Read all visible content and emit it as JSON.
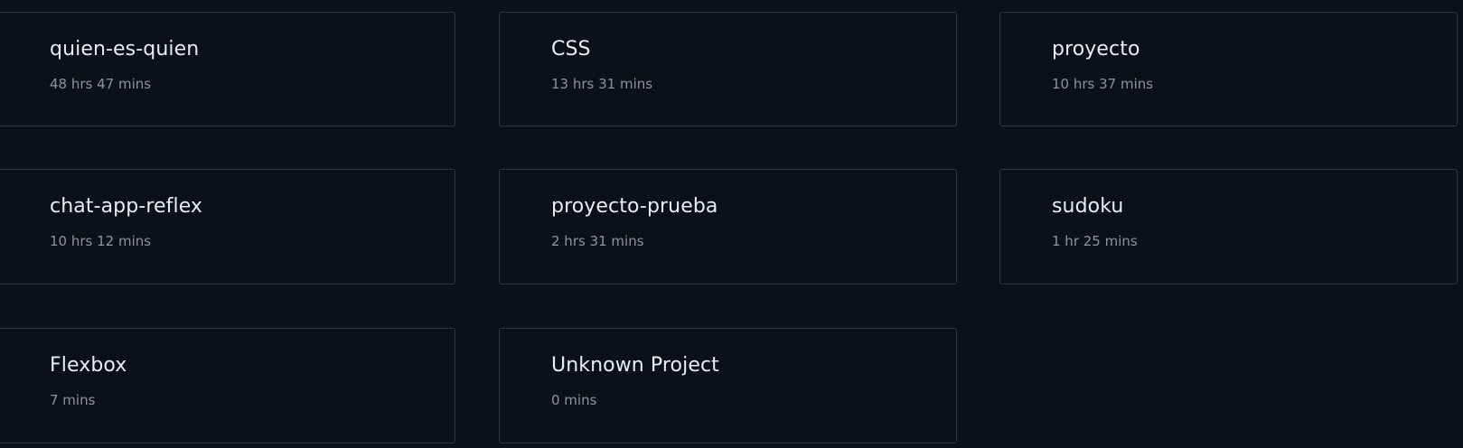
{
  "projects": [
    {
      "name": "quien-es-quien",
      "time": "48 hrs 47 mins"
    },
    {
      "name": "CSS",
      "time": "13 hrs 31 mins"
    },
    {
      "name": "proyecto",
      "time": "10 hrs 37 mins"
    },
    {
      "name": "chat-app-reflex",
      "time": "10 hrs 12 mins"
    },
    {
      "name": "proyecto-prueba",
      "time": "2 hrs 31 mins"
    },
    {
      "name": "sudoku",
      "time": "1 hr 25 mins"
    },
    {
      "name": "Flexbox",
      "time": "7 mins"
    },
    {
      "name": "Unknown Project",
      "time": "0 mins"
    }
  ],
  "colors": {
    "background": "#0d1117",
    "card_border": "#30363d",
    "title_text": "#e6edf3",
    "subtitle_text": "#8b949e"
  }
}
